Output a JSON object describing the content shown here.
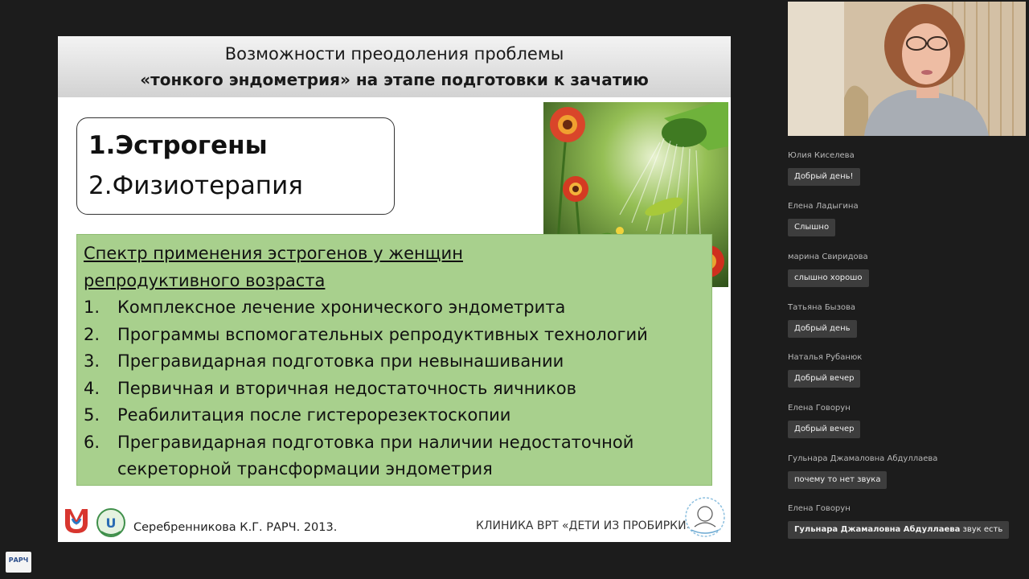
{
  "slide": {
    "header_line1": "Возможности преодоления проблемы",
    "header_line2": "«тонкого эндометрия» на этапе подготовки к зачатию",
    "method1": "1.Эстрогены",
    "method2": "2.Физиотерапия",
    "spectrum_title_line1": "Спектр применения эстрогенов у женщин",
    "spectrum_title_line2": "репродуктивного возраста",
    "items": [
      {
        "num": "1.",
        "text": "Комплексное лечение хронического эндометрита"
      },
      {
        "num": "2.",
        "text": "Программы вспомогательных репродуктивных технологий"
      },
      {
        "num": "3.",
        "text": "Прегравидарная подготовка при невынашивании"
      },
      {
        "num": "4.",
        "text": "Первичная и вторичная недостаточность яичников"
      },
      {
        "num": "5.",
        "text": "Реабилитация после гистерорезектоскопии"
      },
      {
        "num": "6.",
        "text": "Прегравидарная подготовка при наличии недостаточной секреторной трансформации эндометрия"
      }
    ],
    "footer_author": "Серебренникова К.Г. РАРЧ. 2013.",
    "footer_clinic": "КЛИНИКА ВРТ «ДЕТИ ИЗ ПРОБИРКИ»",
    "photo_icon": "garden-watering-can-photo"
  },
  "chat": {
    "messages": [
      {
        "name": "Юлия Киселева",
        "text": "Добрый день!"
      },
      {
        "name": "Елена Ладыгина",
        "text": "Слышно"
      },
      {
        "name": "марина Свиридова",
        "text": "слышно хорошо"
      },
      {
        "name": "Татьяна Бызова",
        "text": "Добрый день"
      },
      {
        "name": "Наталья Рубанюк",
        "text": "Добрый вечер"
      },
      {
        "name": "Елена Говорун",
        "text": "Добрый вечер"
      },
      {
        "name": "Гульнара Джамаловна Абдуллаева",
        "text": "почему то нет звука"
      },
      {
        "name": "Елена Говорун",
        "mention": "Гульнара Джамаловна Абдуллаева",
        "text": " звук есть"
      }
    ]
  },
  "corner_logo": "РАРЧ",
  "colors": {
    "background": "#1c1c1c",
    "green_box": "#a8d08d",
    "chat_bubble": "#3d3d3d"
  }
}
